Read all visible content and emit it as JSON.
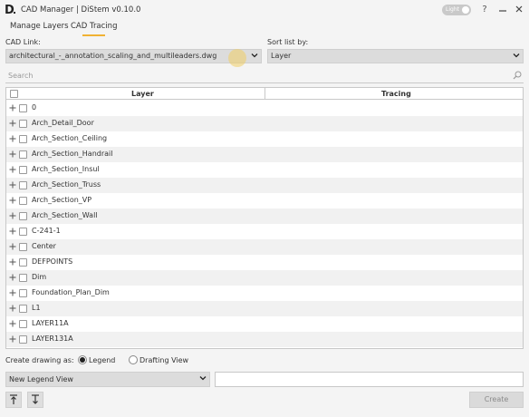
{
  "app": {
    "logo_letter": "D",
    "title": "CAD Manager | DiStem v0.10.0",
    "theme_toggle_label": "Light",
    "help_label": "?"
  },
  "tabs": [
    {
      "label": "Manage Layers",
      "active": false
    },
    {
      "label": "CAD Tracing",
      "active": true
    }
  ],
  "cad_link": {
    "label": "CAD Link:",
    "value": "architectural_-_annotation_scaling_and_multileaders.dwg"
  },
  "sort": {
    "label": "Sort list by:",
    "value": "Layer"
  },
  "search": {
    "placeholder": "Search"
  },
  "table": {
    "columns": [
      "Layer",
      "Tracing"
    ],
    "rows": [
      {
        "layer": "0"
      },
      {
        "layer": "Arch_Detail_Door"
      },
      {
        "layer": "Arch_Section_Ceiling"
      },
      {
        "layer": "Arch_Section_Handrail"
      },
      {
        "layer": "Arch_Section_Insul"
      },
      {
        "layer": "Arch_Section_Truss"
      },
      {
        "layer": "Arch_Section_VP"
      },
      {
        "layer": "Arch_Section_Wall"
      },
      {
        "layer": "C-241-1"
      },
      {
        "layer": "Center"
      },
      {
        "layer": "DEFPOINTS"
      },
      {
        "layer": "Dim"
      },
      {
        "layer": "Foundation_Plan_Dim"
      },
      {
        "layer": "L1"
      },
      {
        "layer": "LAYER11A"
      },
      {
        "layer": "LAYER131A"
      }
    ]
  },
  "create_drawing": {
    "label": "Create drawing as:",
    "options": [
      {
        "label": "Legend",
        "checked": true
      },
      {
        "label": "Drafting View",
        "checked": false
      }
    ],
    "view_type": "New Legend View",
    "name_value": ""
  },
  "buttons": {
    "create": "Create",
    "move_up": "arrow-up-icon",
    "move_down": "arrow-down-icon"
  },
  "colors": {
    "accent": "#f0b233",
    "background": "#f4f4f4"
  }
}
